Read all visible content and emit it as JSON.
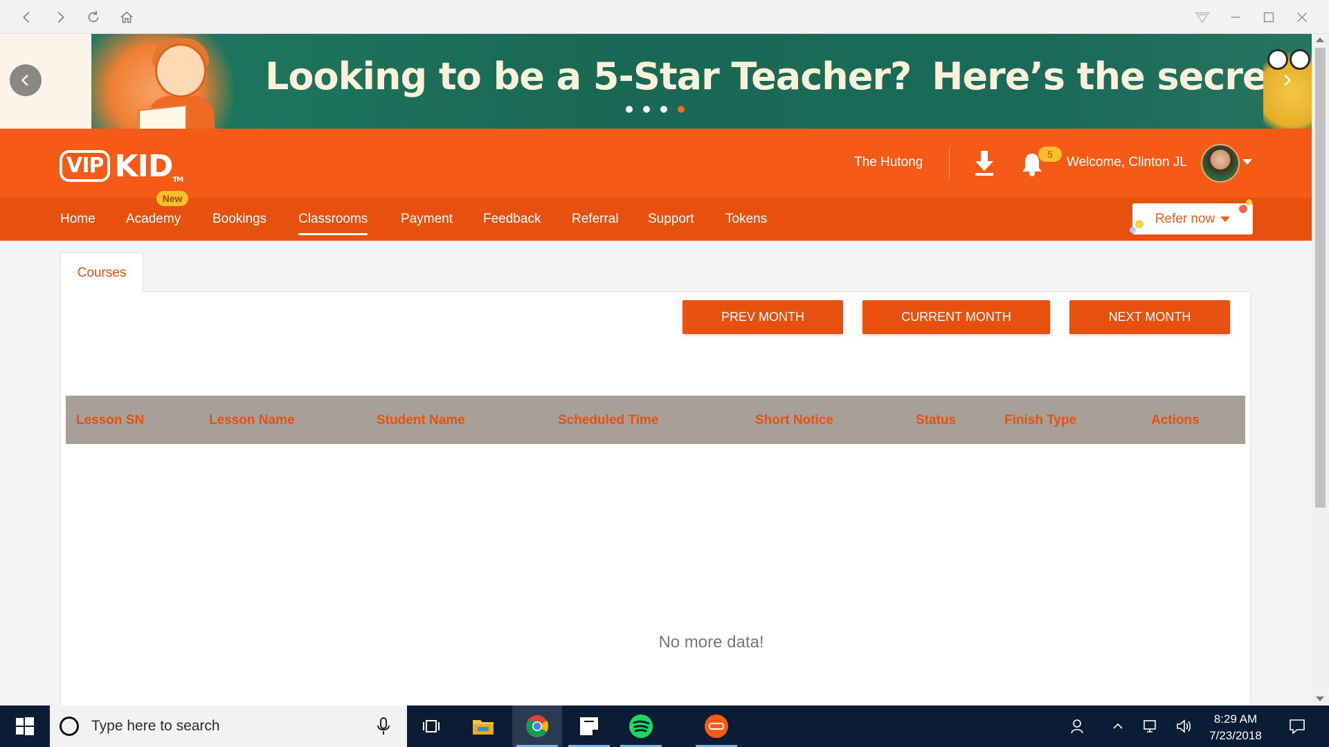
{
  "browser": {
    "icons": [
      "back-icon",
      "forward-icon",
      "reload-icon",
      "home-icon",
      "extension-icon",
      "minimize-icon",
      "maximize-icon",
      "close-icon"
    ]
  },
  "banner": {
    "headline_part1": "Looking to be a 5-Star Teacher?",
    "headline_part2": "Here’s the secret!",
    "slides_total": 4,
    "active_slide": 4
  },
  "header": {
    "logo_vip": "VIP",
    "logo_kid": "KID",
    "logo_tm": "TM",
    "hutong": "The Hutong",
    "notification_count": "5",
    "welcome": "Welcome, Clinton JL"
  },
  "nav": {
    "items": [
      "Home",
      "Academy",
      "Bookings",
      "Classrooms",
      "Payment",
      "Feedback",
      "Referral",
      "Support",
      "Tokens"
    ],
    "active": "Classrooms",
    "new_badge": "New",
    "refer_label": "Refer now"
  },
  "content": {
    "tab_label": "Courses",
    "buttons": {
      "prev": "PREV MONTH",
      "current": "CURRENT MONTH",
      "next": "NEXT MONTH"
    },
    "table_headers": [
      "Lesson SN",
      "Lesson Name",
      "Student Name",
      "Scheduled Time",
      "Short Notice",
      "Status",
      "Finish Type",
      "Actions"
    ],
    "empty_text": "No more data!"
  },
  "taskbar": {
    "search_placeholder": "Type here to search",
    "time": "8:29 AM",
    "date": "7/23/2018"
  },
  "colors": {
    "brand_orange": "#f55a16",
    "nav_orange": "#e8500f",
    "table_header_bg": "#a89f98",
    "badge_yellow": "#f7c02a"
  }
}
